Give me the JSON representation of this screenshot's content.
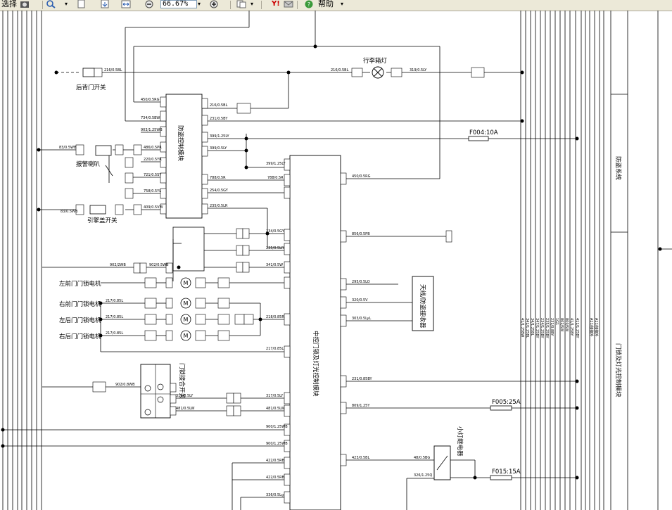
{
  "toolbar": {
    "select_label": "选择",
    "zoom_value": "66.67%",
    "help_label": "帮助",
    "yahoo_label": "Y!"
  },
  "diagram": {
    "labels": {
      "rear_door_switch": "后背门开关",
      "trunk_lamp": "行李箱灯",
      "alarm_horn": "报警喇叭",
      "hood_switch": "引擎盖开关",
      "fl_lock_motor": "左前门门锁电机",
      "fr_lock_motor": "右前门门锁电机",
      "rl_lock_motor": "左后门门锁电机",
      "rr_lock_motor": "右后门门锁电机",
      "burglar_module": "防盗控制模块",
      "central_lock_module": "中控门锁及灯光控制模块",
      "antenna_module": "天线/防盗接收器",
      "door_lock_switch": "门锁接合开关",
      "small_lamp_relay": "小灯继电器",
      "right_band_title": "门锁及灯光控制模块",
      "right_band_title2": "防盗系统"
    },
    "fuses": {
      "f004": "F004:10A",
      "f005": "F005:25A",
      "f015": "F015:15A"
    },
    "wires": {
      "w216": "216/0.5BL",
      "w216b": "216/0.5BL",
      "w319": "319/0.5LY",
      "w450": "450/0.5RG",
      "w216c": "216/0.5BL",
      "w734": "734/0.5BW",
      "w231": "231/0.5BY",
      "w903": "903/1.25WB",
      "w399": "399/1.25LY",
      "w83": "83/0.5WB",
      "w486": "486/0.5PR",
      "w399b": "399/0.5LY",
      "w220": "220/0.5YR",
      "w399c": "399/1.25LY",
      "w721": "721/0.5SY",
      "w788": "788/0.5R",
      "w758": "758/0.5YL",
      "w254": "254/0.5GY",
      "w83b": "83/0.5WB",
      "w409": "409/0.5VW",
      "w235": "235/0.5LR",
      "w450b": "450/0.5RG",
      "w856": "856/0.5PB",
      "w234": "234/0.5GY",
      "w235b": "235/0.5LR",
      "w902": "902/2WB",
      "w902b": "902/0.5WB",
      "w341": "341/0.5W",
      "w295": "295/0.5LO",
      "w320": "320/0.5V",
      "w303": "303/0.5LyL",
      "w217a": "217/0.85L",
      "w217b": "217/0.85L",
      "w217c": "217/0.85L",
      "w217d": "217/0.85L",
      "w218": "218/0.85R",
      "w217e": "217/0.85L",
      "w902c": "902/0.8WB",
      "w317": "317/0.5LY",
      "w481": "481/0.5LW",
      "w231b": "231/0.85BY",
      "w317b": "317/0.5LY",
      "w481b": "481/0.5LW",
      "w809": "809/1.25Y",
      "w900": "900/1.25WB",
      "w900b": "900/1.25WB",
      "w423": "423/0.5BL",
      "w422": "422/0.5RB",
      "w422b": "422/0.5RB",
      "w48": "48/0.5BG",
      "w326": "326/1.25Q",
      "w336": "336/0.5Lg"
    },
    "vertical_labels": [
      "41/1.25BW",
      "341/1.25BL",
      "34/1.25BL",
      "347/1.25BY",
      "234/1.25BY",
      "235/1.25BY",
      "231/0.8BY",
      "1G1",
      "802/5W",
      "800/5W",
      "41/1.25BY",
      "411/1.25BY"
    ],
    "bus_labels": [
      "A11/接接外",
      "A11/接接外"
    ]
  }
}
